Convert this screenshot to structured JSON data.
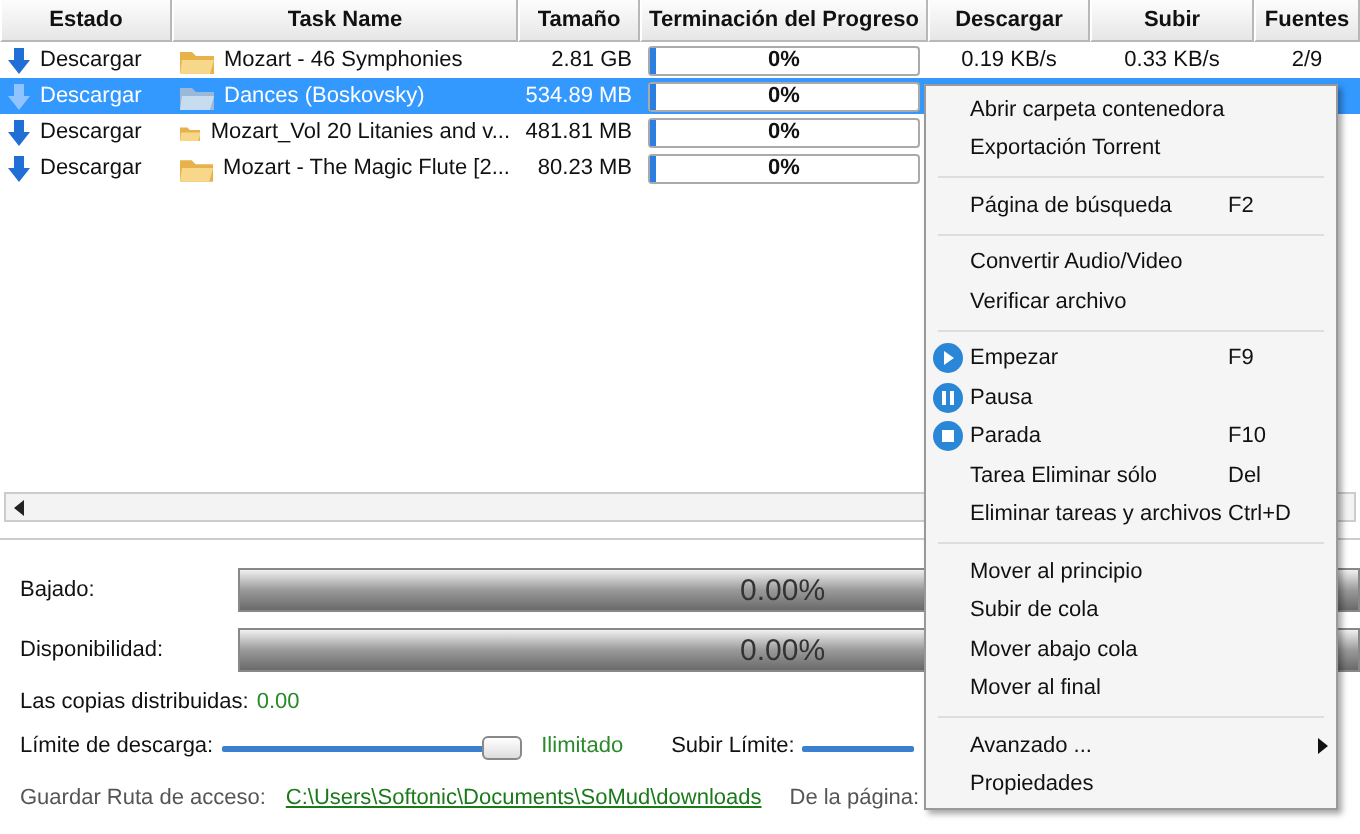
{
  "table": {
    "columns": [
      "Estado",
      "Task Name",
      "Tamaño",
      "Terminación del Progreso",
      "Descargar",
      "Subir",
      "Fuentes"
    ],
    "rows": [
      {
        "status": "Descargar",
        "name": "Mozart - 46 Symphonies",
        "size": "2.81 GB",
        "progress": "0%",
        "level": 0,
        "download": "0.19 KB/s",
        "upload": "0.33 KB/s",
        "sources": "2/9",
        "selected": false
      },
      {
        "status": "Descargar",
        "name": "Dances (Boskovsky)",
        "size": "534.89 MB",
        "progress": "0%",
        "level": 0,
        "selected": true
      },
      {
        "status": "Descargar",
        "name": "Mozart_Vol 20 Litanies and v...",
        "size": "481.81 MB",
        "progress": "0%",
        "level": 0,
        "selected": false
      },
      {
        "status": "Descargar",
        "name": "Mozart - The Magic Flute [2...",
        "size": "80.23 MB",
        "progress": "0%",
        "level": 0,
        "selected": false
      }
    ]
  },
  "details": {
    "downloaded": {
      "label": "Bajado:",
      "reading": "0.00%",
      "level": 0
    },
    "availability": {
      "label": "Disponibilidad:",
      "reading": "0.00%",
      "level": 0
    },
    "copies": {
      "label": "Las copias distribuidas:",
      "value": "0.00"
    },
    "download_limit": {
      "label": "Límite de descarga:",
      "value": "Ilimitado",
      "level": 1
    },
    "upload_limit": {
      "label": "Subir Límite:",
      "level": 1
    },
    "save_path": {
      "label": "Guardar Ruta de acceso:",
      "link": "C:\\Users\\Softonic\\Documents\\SoMud\\downloads"
    },
    "from_page": {
      "label": "De la página:"
    }
  },
  "context_menu": [
    {
      "kind": "item",
      "label": "Abrir carpeta contenedora"
    },
    {
      "kind": "item",
      "label": "Exportación Torrent"
    },
    {
      "kind": "separator"
    },
    {
      "kind": "item",
      "label": "Página de búsqueda",
      "shortcut": "F2"
    },
    {
      "kind": "separator"
    },
    {
      "kind": "item",
      "label": "Convertir Audio/Video"
    },
    {
      "kind": "item",
      "label": "Verificar archivo"
    },
    {
      "kind": "separator"
    },
    {
      "kind": "play",
      "label": "Empezar",
      "shortcut": "F9"
    },
    {
      "kind": "pause",
      "label": "Pausa"
    },
    {
      "kind": "stop",
      "label": "Parada",
      "shortcut": "F10"
    },
    {
      "kind": "item",
      "label": "Tarea Eliminar sólo",
      "shortcut": "Del"
    },
    {
      "kind": "item",
      "label": "Eliminar tareas y archivos",
      "shortcut": "Ctrl+D"
    },
    {
      "kind": "separator"
    },
    {
      "kind": "item",
      "label": "Mover al principio"
    },
    {
      "kind": "item",
      "label": "Subir de cola"
    },
    {
      "kind": "item",
      "label": "Mover abajo cola"
    },
    {
      "kind": "item",
      "label": "Mover al final"
    },
    {
      "kind": "separator"
    },
    {
      "kind": "submenu",
      "label": "Avanzado ..."
    },
    {
      "kind": "item",
      "label": "Propiedades"
    }
  ]
}
